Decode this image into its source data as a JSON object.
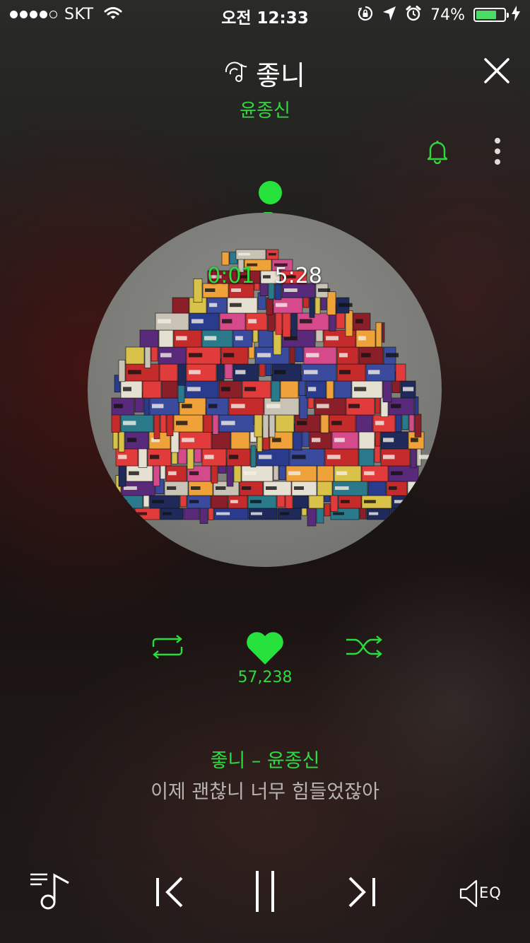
{
  "status_bar": {
    "carrier": "SKT",
    "time": "오전 12:33",
    "battery_percent_label": "74%",
    "battery_level": 0.74,
    "signal_bars": 4,
    "icons": [
      "wifi-icon",
      "rotation-lock-icon",
      "location-arrow-icon",
      "alarm-icon",
      "battery-icon",
      "charging-bolt-icon"
    ]
  },
  "header": {
    "song_title": "좋니",
    "artist": "윤종신",
    "icons": [
      "music-note-icon",
      "close-icon",
      "bell-icon",
      "more-vertical-icon"
    ]
  },
  "player": {
    "elapsed": "0:01",
    "total": "5:28",
    "like_count": "57,238",
    "icons": [
      "repeat-icon",
      "heart-icon",
      "shuffle-icon"
    ]
  },
  "lyrics": {
    "title_line": "좋니 – 윤종신",
    "current_line": "이제 괜찮니 너무 힘들었잖아"
  },
  "controls": {
    "eq_label": "EQ",
    "icons": [
      "playlist-icon",
      "previous-icon",
      "pause-icon",
      "next-icon",
      "speaker-eq-icon"
    ]
  },
  "colors": {
    "accent": "#2bdc3c",
    "lyric_text": "#b8b4b2",
    "battery": "#4cd964"
  }
}
